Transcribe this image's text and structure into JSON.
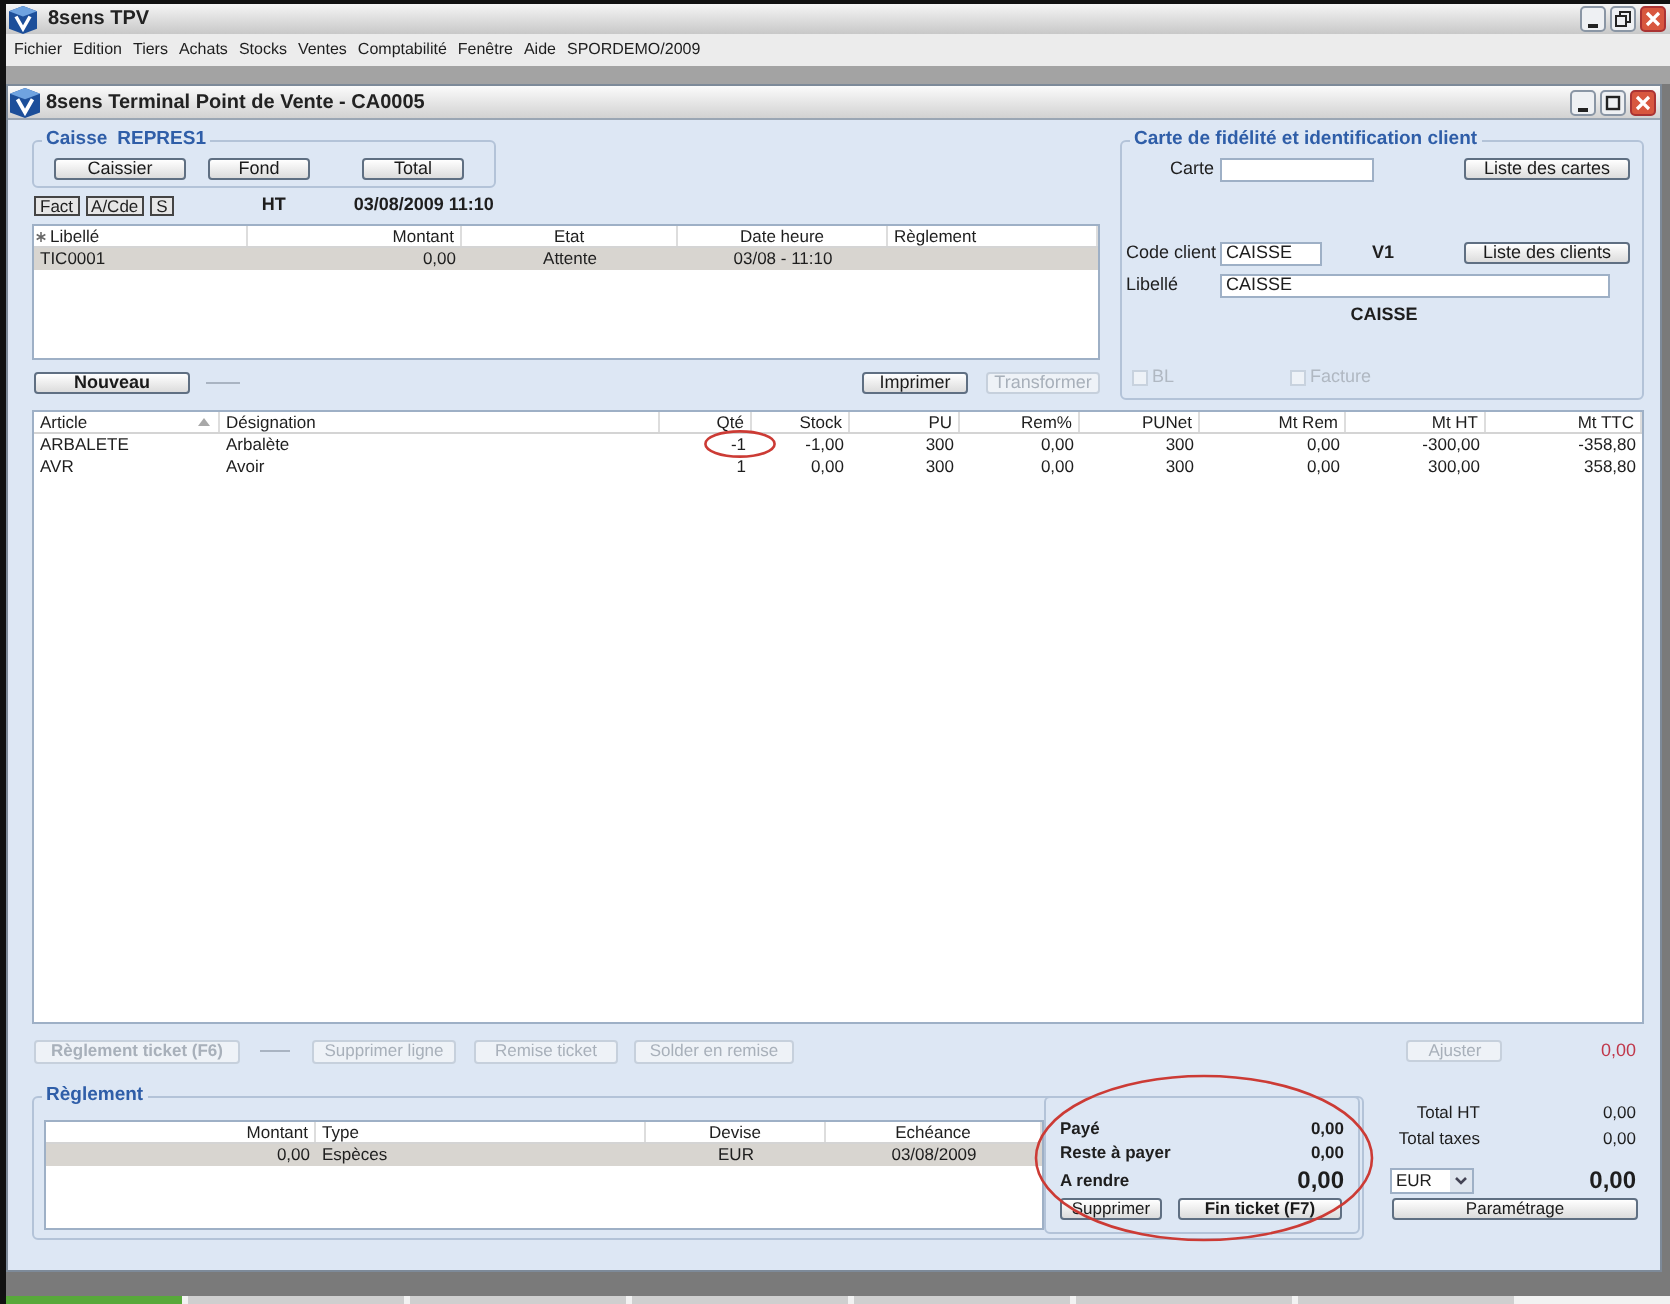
{
  "app_window": {
    "title": "8sens TPV"
  },
  "menu": [
    "Fichier",
    "Edition",
    "Tiers",
    "Achats",
    "Stocks",
    "Ventes",
    "Comptabilité",
    "Fenêtre",
    "Aide",
    "SPORDEMO/2009"
  ],
  "pos_window": {
    "title": "8sens Terminal Point de Vente - CA0005"
  },
  "caisse": {
    "label": "Caisse",
    "name": "REPRES1",
    "buttons": [
      "Caissier",
      "Fond",
      "Total"
    ]
  },
  "doc_types": [
    "Fact",
    "A/Cde",
    "S"
  ],
  "price_mode": "HT",
  "date_time": "03/08/2009 11:10",
  "tickets": {
    "columns": [
      "Libellé",
      "Montant",
      "Etat",
      "Date heure",
      "Règlement"
    ],
    "rows": [
      {
        "cells": [
          "TIC0001",
          "0,00",
          "Attente",
          "03/08 - 11:10"
        ],
        "selected": true
      }
    ]
  },
  "new_button": {
    "label": "Nouveau",
    "disabled": false
  },
  "print_button": {
    "label": "Imprimer",
    "disabled": false
  },
  "transform_button": {
    "label": "Transformer",
    "disabled": true
  },
  "loyalty": {
    "title": "Carte de fidélité et identification client",
    "card": {
      "label": "Carte"
    },
    "card_list_button": "Liste des cartes",
    "client_code": {
      "label": "Code client",
      "value": "CAISSE"
    },
    "price_level": "V1",
    "client_list_button": "Liste des clients",
    "client_label": {
      "label": "Libellé",
      "value": "CAISSE"
    },
    "client_name": "CAISSE",
    "options": [
      {
        "label": "BL",
        "checked": false,
        "disabled": true
      },
      {
        "label": "Facture",
        "checked": false,
        "disabled": true
      }
    ]
  },
  "lines": {
    "columns": [
      {
        "label": "Article",
        "sorted": true
      },
      {
        "label": "Désignation",
        "sorted": false
      },
      {
        "label": "Qté",
        "sorted": false
      },
      {
        "label": "Stock",
        "sorted": false
      },
      {
        "label": "PU",
        "sorted": false
      },
      {
        "label": "Rem%",
        "sorted": false
      },
      {
        "label": "PUNet",
        "sorted": false
      },
      {
        "label": "Mt Rem",
        "sorted": false
      },
      {
        "label": "Mt HT",
        "sorted": false
      },
      {
        "label": "Mt TTC",
        "sorted": false
      }
    ],
    "rows": [
      {
        "cells": [
          "ARBALETE",
          "Arbalète",
          "-1",
          "-1,00",
          "300",
          "0,00",
          "300",
          "0,00",
          "-300,00",
          "-358,80"
        ],
        "qty_circled": true
      },
      {
        "cells": [
          "AVR",
          "Avoir",
          "1",
          "0,00",
          "300",
          "0,00",
          "300",
          "0,00",
          "300,00",
          "358,80"
        ],
        "qty_circled": false
      }
    ]
  },
  "line_actions": [
    {
      "label": "Règlement ticket (F6)",
      "kind": "primary",
      "disabled": true
    },
    {
      "label": "Supprimer ligne",
      "kind": "normal",
      "disabled": true
    },
    {
      "label": "Remise ticket",
      "kind": "normal",
      "disabled": true
    },
    {
      "label": "Solder en remise",
      "kind": "normal",
      "disabled": true
    }
  ],
  "adjust": {
    "button": {
      "label": "Ajuster",
      "disabled": true
    },
    "amount": "0,00"
  },
  "payments": {
    "title": "Règlement",
    "columns": [
      "Montant",
      "Type",
      "Devise",
      "Echéance"
    ],
    "rows": [
      {
        "cells": [
          "0,00",
          "Espèces",
          "EUR",
          "03/08/2009"
        ],
        "selected": true
      }
    ]
  },
  "summary": {
    "circled": true,
    "lines": [
      {
        "label": "Payé",
        "value": "0,00",
        "kind": "normal"
      },
      {
        "label": "Reste à payer",
        "value": "0,00",
        "kind": "normal"
      },
      {
        "label": "A rendre",
        "value": "0,00",
        "kind": "large"
      }
    ],
    "buttons": [
      {
        "label": "Supprimer",
        "kind": "normal"
      },
      {
        "label": "Fin ticket (F7)",
        "kind": "primary"
      }
    ]
  },
  "totals": {
    "lines": [
      {
        "label": "Total HT",
        "value": "0,00"
      },
      {
        "label": "Total taxes",
        "value": "0,00"
      }
    ],
    "currency": "EUR",
    "grand_total": "0,00",
    "settings_button": "Paramétrage"
  }
}
